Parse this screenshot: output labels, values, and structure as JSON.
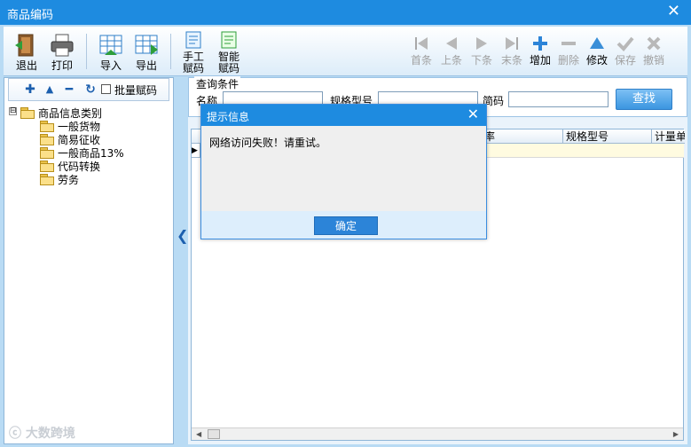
{
  "window": {
    "title": "商品编码"
  },
  "toolbar": {
    "exit": "退出",
    "print": "打印",
    "import": "导入",
    "export": "导出",
    "manual_code": [
      "手工",
      "赋码"
    ],
    "smart_code": [
      "智能",
      "赋码"
    ],
    "first": "首条",
    "prev": "上条",
    "next": "下条",
    "last": "末条",
    "add": "增加",
    "delete": "删除",
    "modify": "修改",
    "save": "保存",
    "undo": "撤销"
  },
  "tree": {
    "batch_label": "批量赋码",
    "root": "商品信息类别",
    "root_toggle": "⊟",
    "children": [
      "一般货物",
      "简易征收",
      "一般商品13%",
      "代码转换",
      "劳务"
    ]
  },
  "query": {
    "legend": "查询条件",
    "name_label": "名称",
    "spec_label": "规格型号",
    "code_label": "简码",
    "search_button": "查找"
  },
  "grid": {
    "columns": [
      "",
      "率",
      "规格型号",
      "计量单"
    ]
  },
  "dialog": {
    "title": "提示信息",
    "message": "网络访问失败！请重试。",
    "ok": "确定"
  },
  "watermark": "ⓒ 大数跨境",
  "colors": {
    "titlebar": "#1e8be0",
    "accent": "#2c84d8",
    "panel": "#b9dbf4"
  }
}
